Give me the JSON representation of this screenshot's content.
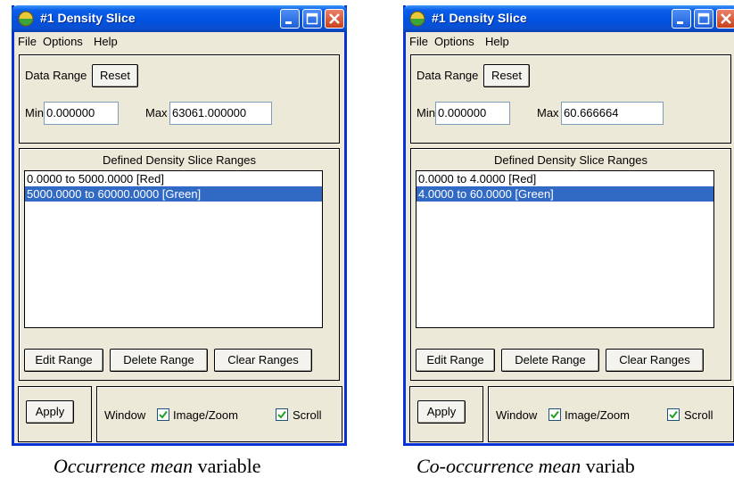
{
  "panels": [
    {
      "title": "#1 Density Slice",
      "menu": [
        "File",
        "Options",
        "Help"
      ],
      "data_range_label": "Data Range",
      "reset_label": "Reset",
      "min_label": "Min",
      "min_value": "0.000000",
      "max_label": "Max",
      "max_value": "63061.000000",
      "defined_label": "Defined Density Slice Ranges",
      "ranges": [
        "0.0000 to 5000.0000 [Red]",
        "5000.0000 to 60000.0000 [Green]"
      ],
      "selected_range_index": 1,
      "edit_range_label": "Edit Range",
      "delete_range_label": "Delete Range",
      "clear_ranges_label": "Clear Ranges",
      "apply_label": "Apply",
      "window_label": "Window",
      "image_zoom_label": "Image/Zoom",
      "image_zoom_checked": true,
      "scroll_label": "Scroll",
      "scroll_checked": true,
      "caption_italic": "Occurrence mean",
      "caption_rest": " variable"
    },
    {
      "title": "#1 Density Slice",
      "menu": [
        "File",
        "Options",
        "Help"
      ],
      "data_range_label": "Data Range",
      "reset_label": "Reset",
      "min_label": "Min",
      "min_value": "0.000000",
      "max_label": "Max",
      "max_value": "60.666664",
      "defined_label": "Defined Density Slice Ranges",
      "ranges": [
        "0.0000 to 4.0000 [Red]",
        "4.0000 to 60.0000 [Green]"
      ],
      "selected_range_index": 1,
      "edit_range_label": "Edit Range",
      "delete_range_label": "Delete Range",
      "clear_ranges_label": "Clear Ranges",
      "apply_label": "Apply",
      "window_label": "Window",
      "image_zoom_label": "Image/Zoom",
      "image_zoom_checked": true,
      "scroll_label": "Scroll",
      "scroll_checked": true,
      "caption_italic": "Co-occurrence mean",
      "caption_rest": " variab"
    }
  ],
  "colors": {
    "title_bar": "#0053e1",
    "window_bg": "#ece9d8",
    "selection": "#316ac5",
    "check_mark": "#21a121"
  }
}
